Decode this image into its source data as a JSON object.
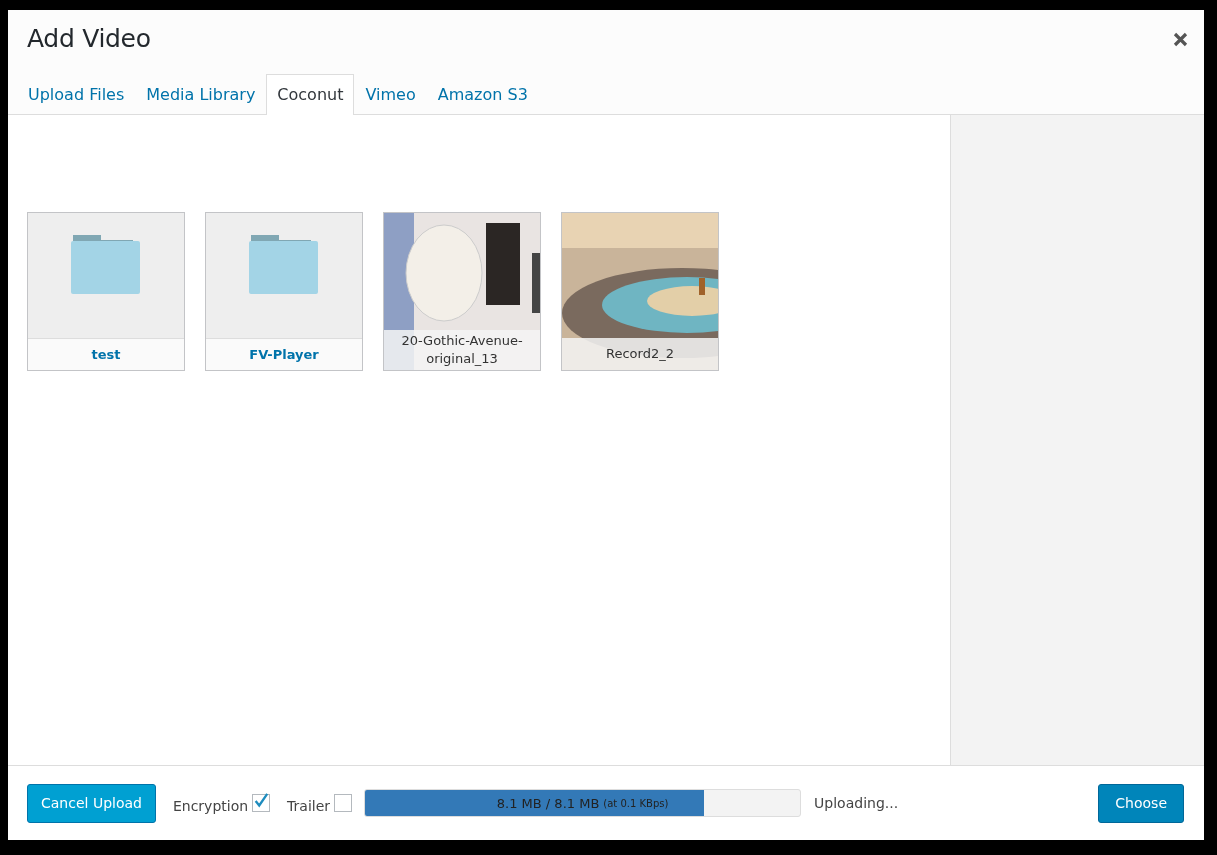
{
  "window": {
    "title": "Add Video"
  },
  "tabs": [
    {
      "label": "Upload Files",
      "selected": false
    },
    {
      "label": "Media Library",
      "selected": false
    },
    {
      "label": "Coconut",
      "selected": true
    },
    {
      "label": "Vimeo",
      "selected": false
    },
    {
      "label": "Amazon S3",
      "selected": false
    }
  ],
  "items": [
    {
      "kind": "folder",
      "name": "test"
    },
    {
      "kind": "folder",
      "name": "FV-Player"
    },
    {
      "kind": "video",
      "name": "20-Gothic-Avenue-original_13"
    },
    {
      "kind": "video",
      "name": "Record2_2"
    }
  ],
  "footer": {
    "cancel_button": "Cancel Upload",
    "options": [
      {
        "label": "Encryption",
        "checked": true
      },
      {
        "label": "Trailer",
        "checked": false
      }
    ],
    "progress": {
      "text": "8.1 MB / 8.1 MB",
      "rate": "(at 0.1 KBps)",
      "level": 0.78
    },
    "status": "Uploading...",
    "choose_button": "Choose"
  }
}
